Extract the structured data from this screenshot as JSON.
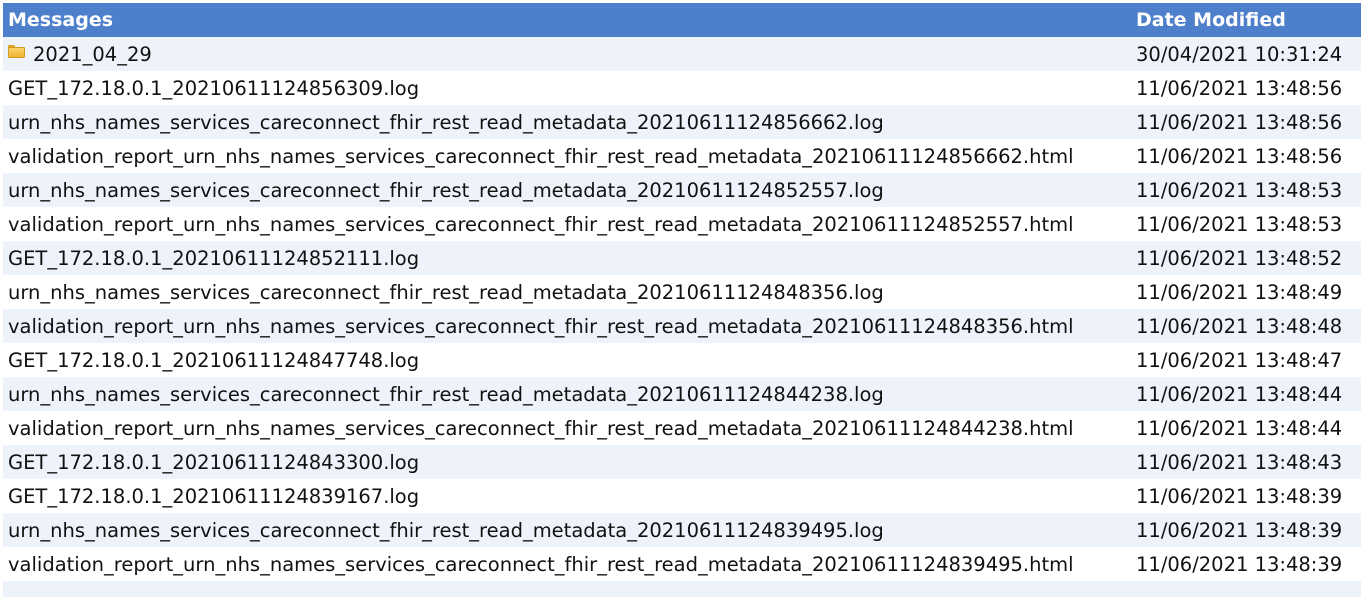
{
  "header": {
    "name_label": "Messages",
    "date_label": "Date Modified"
  },
  "rows": [
    {
      "name": "2021_04_29",
      "date": "30/04/2021 10:31:24",
      "icon": "folder-icon"
    },
    {
      "name": "GET_172.18.0.1_20210611124856309.log",
      "date": "11/06/2021 13:48:56"
    },
    {
      "name": "urn_nhs_names_services_careconnect_fhir_rest_read_metadata_20210611124856662.log",
      "date": "11/06/2021 13:48:56"
    },
    {
      "name": "validation_report_urn_nhs_names_services_careconnect_fhir_rest_read_metadata_20210611124856662.html",
      "date": "11/06/2021 13:48:56"
    },
    {
      "name": "urn_nhs_names_services_careconnect_fhir_rest_read_metadata_20210611124852557.log",
      "date": "11/06/2021 13:48:53"
    },
    {
      "name": "validation_report_urn_nhs_names_services_careconnect_fhir_rest_read_metadata_20210611124852557.html",
      "date": "11/06/2021 13:48:53"
    },
    {
      "name": "GET_172.18.0.1_20210611124852111.log",
      "date": "11/06/2021 13:48:52"
    },
    {
      "name": "urn_nhs_names_services_careconnect_fhir_rest_read_metadata_20210611124848356.log",
      "date": "11/06/2021 13:48:49"
    },
    {
      "name": "validation_report_urn_nhs_names_services_careconnect_fhir_rest_read_metadata_20210611124848356.html",
      "date": "11/06/2021 13:48:48"
    },
    {
      "name": "GET_172.18.0.1_20210611124847748.log",
      "date": "11/06/2021 13:48:47"
    },
    {
      "name": "urn_nhs_names_services_careconnect_fhir_rest_read_metadata_20210611124844238.log",
      "date": "11/06/2021 13:48:44"
    },
    {
      "name": "validation_report_urn_nhs_names_services_careconnect_fhir_rest_read_metadata_20210611124844238.html",
      "date": "11/06/2021 13:48:44"
    },
    {
      "name": "GET_172.18.0.1_20210611124843300.log",
      "date": "11/06/2021 13:48:43"
    },
    {
      "name": "GET_172.18.0.1_20210611124839167.log",
      "date": "11/06/2021 13:48:39"
    },
    {
      "name": "urn_nhs_names_services_careconnect_fhir_rest_read_metadata_20210611124839495.log",
      "date": "11/06/2021 13:48:39"
    },
    {
      "name": "validation_report_urn_nhs_names_services_careconnect_fhir_rest_read_metadata_20210611124839495.html",
      "date": "11/06/2021 13:48:39"
    }
  ],
  "colors": {
    "header_bg": "#4d7fcb",
    "alt_row_bg": "#eef2fa"
  }
}
